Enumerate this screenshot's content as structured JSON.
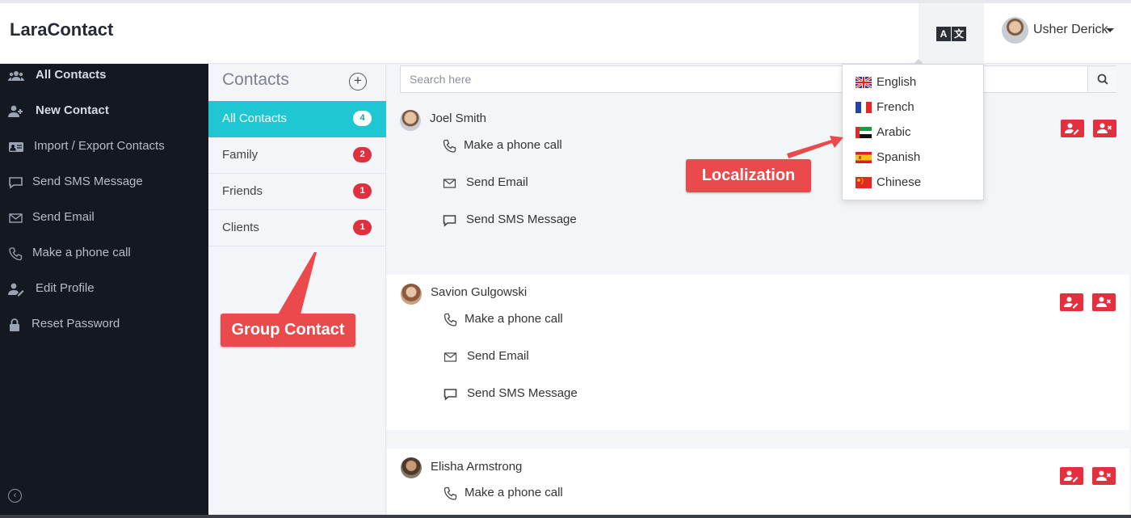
{
  "app": {
    "brand": "LaraContact"
  },
  "header": {
    "user_name": "Usher Derick",
    "language_glyph_a": "A",
    "language_glyph_b": "文"
  },
  "sidebar": {
    "items": [
      {
        "label": "All Contacts",
        "icon": "users-icon"
      },
      {
        "label": "New Contact",
        "icon": "user-plus-icon"
      },
      {
        "label": "Import / Export Contacts",
        "icon": "id-card-icon"
      },
      {
        "label": "Send SMS Message",
        "icon": "message-icon"
      },
      {
        "label": "Send Email",
        "icon": "envelope-icon"
      },
      {
        "label": "Make a phone call",
        "icon": "phone-icon"
      },
      {
        "label": "Edit Profile",
        "icon": "user-edit-icon"
      },
      {
        "label": "Reset Password",
        "icon": "lock-icon"
      }
    ],
    "collapse_glyph": "‹"
  },
  "groups": {
    "title": "Contacts",
    "items": [
      {
        "label": "All Contacts",
        "count": "4",
        "active": true
      },
      {
        "label": "Family",
        "count": "2"
      },
      {
        "label": "Friends",
        "count": "1"
      },
      {
        "label": "Clients",
        "count": "1"
      }
    ]
  },
  "search": {
    "placeholder": "Search here"
  },
  "contacts": [
    {
      "name": "Joel Smith",
      "actions": {
        "call": "Make a phone call",
        "email": "Send Email",
        "sms": "Send SMS Message"
      }
    },
    {
      "name": "Savion Gulgowski",
      "actions": {
        "call": "Make a phone call",
        "email": "Send Email",
        "sms": "Send SMS Message"
      }
    },
    {
      "name": "Elisha Armstrong",
      "actions": {
        "call": "Make a phone call"
      }
    }
  ],
  "languages": [
    {
      "label": "English",
      "flag": "uk-flag-icon"
    },
    {
      "label": "French",
      "flag": "france-flag-icon"
    },
    {
      "label": "Arabic",
      "flag": "uae-flag-icon"
    },
    {
      "label": "Spanish",
      "flag": "spain-flag-icon"
    },
    {
      "label": "Chinese",
      "flag": "china-flag-icon"
    }
  ],
  "annotations": {
    "localization": "Localization",
    "group_contact": "Group Contact"
  },
  "colors": {
    "accent": "#1ec7d2",
    "danger": "#e3303f",
    "sidebar": "#141820",
    "callout": "#ea4a4b"
  }
}
